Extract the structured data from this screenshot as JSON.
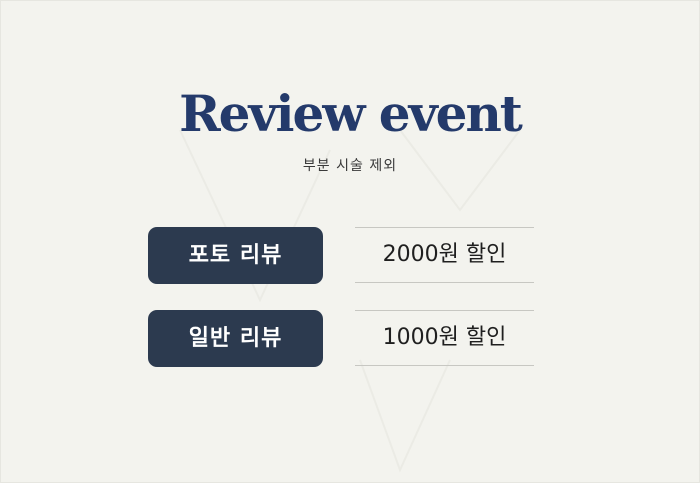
{
  "event": {
    "title": "Review event",
    "subtitle": "부분 시술 제외"
  },
  "rows": [
    {
      "label": "포토 리뷰",
      "value": "2000원 할인"
    },
    {
      "label": "일반 리뷰",
      "value": "1000원 할인"
    }
  ],
  "colors": {
    "background": "#f3f3ee",
    "title": "#243a6b",
    "label_bg": "#2c3a4f",
    "label_text": "#ffffff",
    "divider": "#c7c7c2"
  }
}
